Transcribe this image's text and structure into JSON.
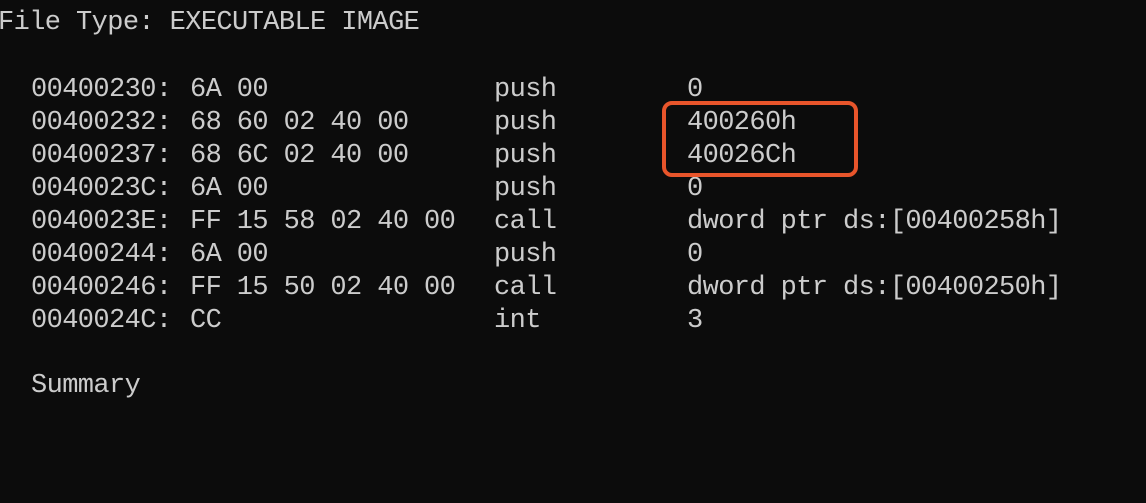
{
  "header": {
    "file_type_line": "File Type: EXECUTABLE IMAGE"
  },
  "disassembly": [
    {
      "address": "00400230:",
      "bytes": "6A 00",
      "mnemonic": "push",
      "operand": "0"
    },
    {
      "address": "00400232:",
      "bytes": "68 60 02 40 00",
      "mnemonic": "push",
      "operand": "400260h"
    },
    {
      "address": "00400237:",
      "bytes": "68 6C 02 40 00",
      "mnemonic": "push",
      "operand": "40026Ch"
    },
    {
      "address": "0040023C:",
      "bytes": "6A 00",
      "mnemonic": "push",
      "operand": "0"
    },
    {
      "address": "0040023E:",
      "bytes": "FF 15 58 02 40 00",
      "mnemonic": "call",
      "operand": "dword ptr ds:[00400258h]"
    },
    {
      "address": "00400244:",
      "bytes": "6A 00",
      "mnemonic": "push",
      "operand": "0"
    },
    {
      "address": "00400246:",
      "bytes": "FF 15 50 02 40 00",
      "mnemonic": "call",
      "operand": "dword ptr ds:[00400250h]"
    },
    {
      "address": "0040024C:",
      "bytes": "CC",
      "mnemonic": "int",
      "operand": "3"
    }
  ],
  "footer": {
    "summary_label": "Summary"
  },
  "colors": {
    "background": "#0c0c0c",
    "text": "#cccccc",
    "highlight_border": "#e8552b"
  }
}
